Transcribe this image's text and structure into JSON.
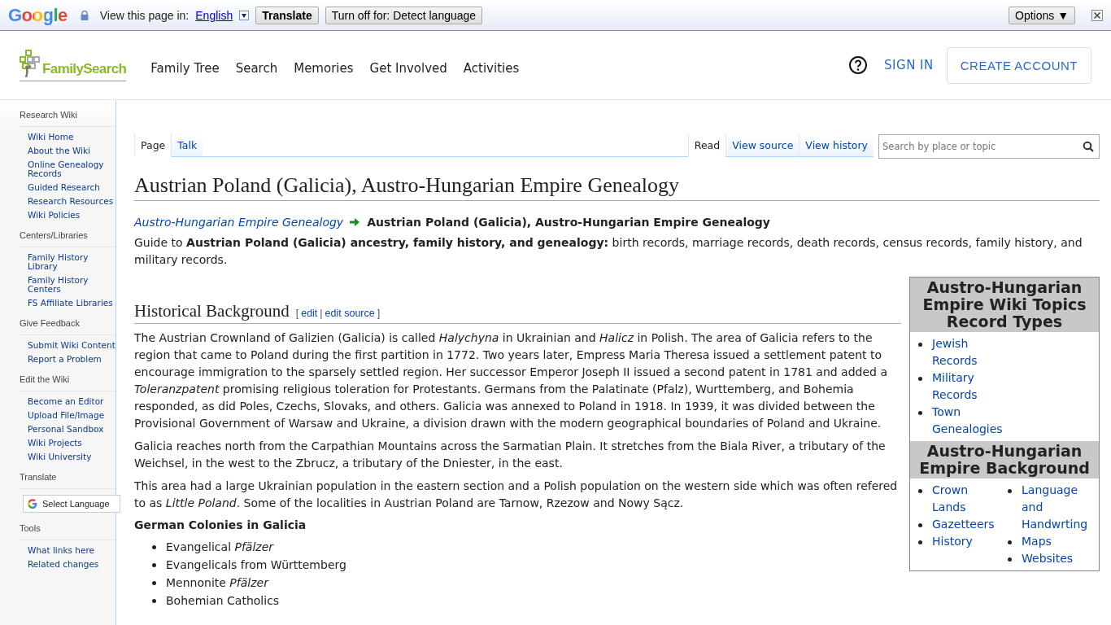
{
  "translate_bar": {
    "logo": "Google",
    "label": "View this page in:",
    "language": "English",
    "buttons": [
      "Translate",
      "Turn off for: Detect language"
    ],
    "options": "Options ▼"
  },
  "header": {
    "logo_text": "FamilySearch",
    "nav": [
      "Family Tree",
      "Search",
      "Memories",
      "Get Involved",
      "Activities"
    ],
    "sign_in": "SIGN IN",
    "create_account": "CREATE ACCOUNT"
  },
  "sidebar": {
    "sections": [
      {
        "heading": "Research Wiki",
        "items": [
          "Wiki Home",
          "About the Wiki",
          "Online Genealogy Records",
          "Guided Research",
          "Research Resources",
          "Wiki Policies"
        ]
      },
      {
        "heading": "Centers/Libraries",
        "items": [
          "Family History Library",
          "Family History Centers",
          "FS Affiliate Libraries"
        ]
      },
      {
        "heading": "Give Feedback",
        "items": [
          "Submit Wiki Content",
          "Report a Problem"
        ]
      },
      {
        "heading": "Edit the Wiki",
        "items": [
          "Become an Editor",
          "Upload File/Image",
          "Personal Sandbox",
          "Wiki Projects",
          "Wiki University"
        ]
      },
      {
        "heading": "Translate",
        "widget": "Select Language"
      },
      {
        "heading": "Tools",
        "items": [
          "What links here",
          "Related changes"
        ]
      }
    ]
  },
  "page_tabs": [
    {
      "label": "Page",
      "selected": true
    },
    {
      "label": "Talk",
      "selected": false
    }
  ],
  "view_tabs": [
    {
      "label": "Read",
      "selected": true
    },
    {
      "label": "View source",
      "selected": false
    },
    {
      "label": "View history",
      "selected": false
    }
  ],
  "search": {
    "placeholder": "Search by place or topic"
  },
  "article": {
    "title": "Austrian Poland (Galicia), Austro-Hungarian Empire Genealogy",
    "breadcrumb": {
      "parent": "Austro-Hungarian Empire Genealogy",
      "current": "Austrian Poland (Galicia), Austro-Hungarian Empire Genealogy"
    },
    "intro": "Guide to **Austrian Poland (Galicia) ancestry, family history, and genealogy:** birth records, marriage records, death records, census records, family history, and military records.",
    "section": {
      "heading": "Historical Background",
      "edit_links": [
        {
          "kind": "mark",
          "text": "["
        },
        {
          "kind": "link",
          "text": "edit"
        },
        {
          "kind": "mark",
          "text": "|"
        },
        {
          "kind": "link",
          "text": "edit source"
        },
        {
          "kind": "mark",
          "text": "]"
        }
      ],
      "paragraphs": [
        "The Austrian Crownland of Galizien (Galicia) is called *Halychyna* in Ukrainian and *Halicz* in Polish. The area of Galicia refers to the region that came to Poland during the first partition in 1772. Two years later, Empress Maria Theresa issued a settlement patent to encourage immigration to the sparsely settled region. Her successor Emperor Joseph II issued a second patent in 1781 and added a *Toleranzpatent* promising religious toleration for Protestants. Germans from the Palatinate (Pfalz), Wurttemberg, and Bohemia responded, as did Poles, Czechs, Slovaks, and others. Galicia was annexed to Poland in 1918. In 1939, it was divided between the Provisional Government of Warsaw and Ukraine, a division drawn with the modern geographical boundaries of Poland and Ukraine.",
        "Galicia reaches north from the Carpathian Mountains across the Sarmatian Plain. It stretches from the Biala River, a tributary of the Weichsel, in the west to the Zbrucz, a tributary of the Dniester, in the east.",
        "This area had a large Ukrainian population in the eastern section and a Polish population on the western side which was often refered to as *Little Poland*. Some of the localities in Austrian Poland are Tarnow, Rzezow and Nowy Sącz."
      ],
      "subheading": "German Colonies in Galicia",
      "list": [
        "Evangelical *Pfälzer*",
        "Evangelicals from Württemberg",
        "Mennonite *Pfälzer*",
        "Bohemian Catholics"
      ]
    }
  },
  "infobox": {
    "sections": [
      {
        "heading": "Austro-Hungarian Empire Wiki Topics Record Types",
        "columns": [
          [
            "Jewish Records",
            "Military Records",
            "Town Genealogies"
          ]
        ]
      },
      {
        "heading": "Austro-Hungarian Empire Background",
        "columns": [
          [
            "Crown Lands",
            "Gazetteers",
            "History"
          ],
          [
            "Language and Handwrting",
            "Maps",
            "Websites"
          ]
        ]
      }
    ]
  }
}
